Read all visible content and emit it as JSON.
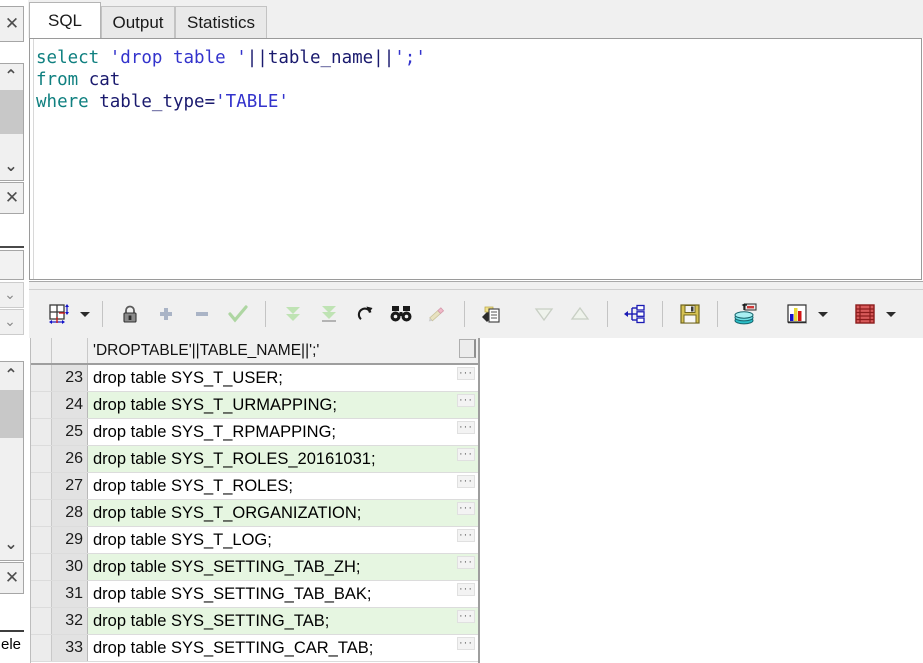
{
  "tabs": [
    {
      "label": "SQL",
      "active": true
    },
    {
      "label": "Output",
      "active": false
    },
    {
      "label": "Statistics",
      "active": false
    }
  ],
  "editor": {
    "lines": [
      {
        "tokens": [
          {
            "t": "select",
            "c": "kw"
          },
          {
            "t": " ",
            "c": "pln"
          },
          {
            "t": "'drop table '",
            "c": "str"
          },
          {
            "t": "||",
            "c": "op"
          },
          {
            "t": "table_name",
            "c": "pln"
          },
          {
            "t": "||",
            "c": "op"
          },
          {
            "t": "';'",
            "c": "str"
          }
        ]
      },
      {
        "tokens": [
          {
            "t": "from",
            "c": "kw"
          },
          {
            "t": " ",
            "c": "pln"
          },
          {
            "t": "cat",
            "c": "pln"
          }
        ]
      },
      {
        "tokens": [
          {
            "t": "where",
            "c": "kw"
          },
          {
            "t": " ",
            "c": "pln"
          },
          {
            "t": "table_type=",
            "c": "pln"
          },
          {
            "t": "'TABLE'",
            "c": "str"
          }
        ]
      }
    ],
    "plain_text": "select 'drop table '||table_name||';'\nfrom cat\nwhere table_type='TABLE'"
  },
  "toolbar": {
    "buttons": [
      {
        "name": "grid-resize-icon",
        "label": "Grid layout",
        "enabled": true,
        "dropdown": true
      },
      {
        "name": "lock-icon",
        "label": "Lock record",
        "enabled": true,
        "dropdown": false
      },
      {
        "name": "plus-icon",
        "label": "Insert record",
        "enabled": false,
        "dropdown": false
      },
      {
        "name": "minus-icon",
        "label": "Delete record",
        "enabled": false,
        "dropdown": false
      },
      {
        "name": "check-icon",
        "label": "Post changes",
        "enabled": false,
        "dropdown": false
      },
      {
        "name": "fetch-next-page-icon",
        "label": "Fetch next page",
        "enabled": false,
        "dropdown": false
      },
      {
        "name": "fetch-last-page-icon",
        "label": "Fetch last page",
        "enabled": false,
        "dropdown": false
      },
      {
        "name": "refresh-icon",
        "label": "Refresh",
        "enabled": true,
        "dropdown": false
      },
      {
        "name": "binoculars-icon",
        "label": "Find",
        "enabled": true,
        "dropdown": false
      },
      {
        "name": "pencil-icon",
        "label": "Edit data",
        "enabled": false,
        "dropdown": false
      },
      {
        "name": "copy-to-clipboard-icon",
        "label": "Copy to clipboard",
        "enabled": true,
        "dropdown": false
      },
      {
        "name": "sort-descending-icon",
        "label": "Sort descending",
        "enabled": false,
        "dropdown": false
      },
      {
        "name": "sort-ascending-icon",
        "label": "Sort ascending",
        "enabled": false,
        "dropdown": false
      },
      {
        "name": "hierarchy-icon",
        "label": "Query builder",
        "enabled": true,
        "dropdown": false
      },
      {
        "name": "save-icon",
        "label": "Save",
        "enabled": true,
        "dropdown": false
      },
      {
        "name": "export-data-icon",
        "label": "Export data",
        "enabled": true,
        "dropdown": false
      },
      {
        "name": "chart-icon",
        "label": "Chart",
        "enabled": true,
        "dropdown": true
      },
      {
        "name": "grid-view-icon",
        "label": "Grid view",
        "enabled": true,
        "dropdown": true
      }
    ]
  },
  "grid": {
    "column_header": "'DROPTABLE'||TABLE_NAME||';'",
    "ellipsis_label": "···",
    "rows": [
      {
        "num": "23",
        "value": "drop table SYS_T_USER;"
      },
      {
        "num": "24",
        "value": "drop table SYS_T_URMAPPING;"
      },
      {
        "num": "25",
        "value": "drop table SYS_T_RPMAPPING;"
      },
      {
        "num": "26",
        "value": "drop table SYS_T_ROLES_20161031;"
      },
      {
        "num": "27",
        "value": "drop table SYS_T_ROLES;"
      },
      {
        "num": "28",
        "value": "drop table SYS_T_ORGANIZATION;"
      },
      {
        "num": "29",
        "value": "drop table SYS_T_LOG;"
      },
      {
        "num": "30",
        "value": "drop table SYS_SETTING_TAB_ZH;"
      },
      {
        "num": "31",
        "value": "drop table SYS_SETTING_TAB_BAK;"
      },
      {
        "num": "32",
        "value": "drop table SYS_SETTING_TAB;"
      },
      {
        "num": "33",
        "value": "drop table SYS_SETTING_CAR_TAB;"
      }
    ]
  },
  "left_edge": {
    "close_glyph": "✕",
    "up_glyph": "⌃",
    "down_glyph": "⌄",
    "text_fragment": "ele"
  },
  "colors": {
    "keyword": "#108080",
    "string": "#3333cc",
    "row_stripe": "#e6f6e1",
    "toolbar_bg": "#f0f0f0",
    "tab_active_bg": "#ffffff"
  }
}
